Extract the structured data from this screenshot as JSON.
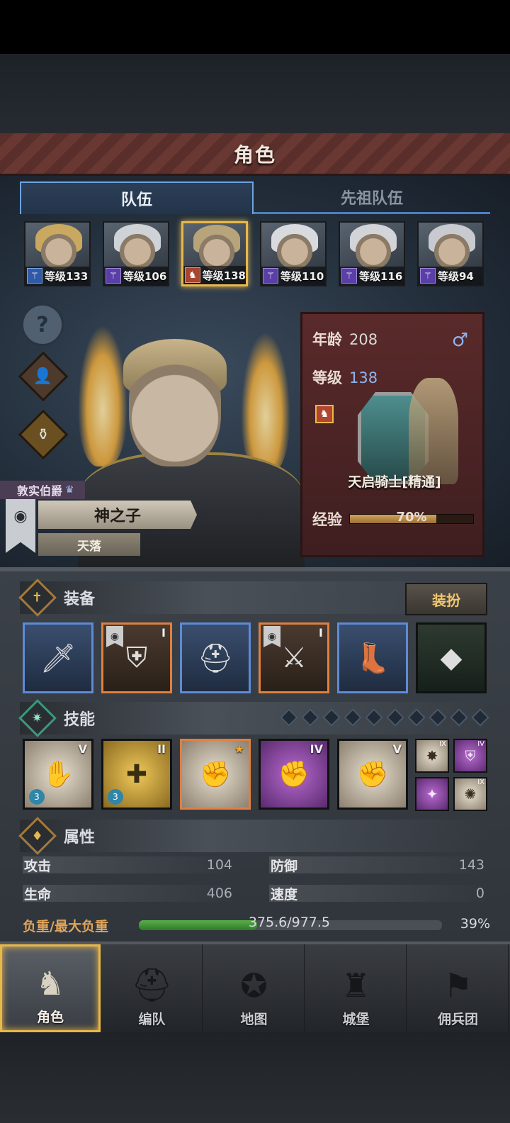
{
  "header": {
    "title": "角色"
  },
  "tabs": [
    {
      "label": "队伍",
      "active": true
    },
    {
      "label": "先祖队伍",
      "active": false
    }
  ],
  "portraits": [
    {
      "level": "等级133",
      "class_color": "blue",
      "hair": "#c9a860",
      "selected": false
    },
    {
      "level": "等级106",
      "class_color": "purple",
      "hair": "#cfd2d6",
      "selected": false
    },
    {
      "level": "等级138",
      "class_color": "red",
      "hair": "#b8a47a",
      "selected": true
    },
    {
      "level": "等级110",
      "class_color": "purple",
      "hair": "#d8dadd",
      "selected": false
    },
    {
      "level": "等级116",
      "class_color": "purple",
      "hair": "#d2d4d8",
      "selected": false
    },
    {
      "level": "等级94",
      "class_color": "purple",
      "hair": "#c8cacf",
      "selected": false
    }
  ],
  "side_buttons": {
    "help_icon": "?",
    "armor_icon": "armor-icon",
    "potion_icon": "potion-icon"
  },
  "hero": {
    "noble_title": "敦实伯爵",
    "name": "神之子",
    "subtitle": "天落"
  },
  "info": {
    "age_label": "年龄",
    "age_value": "208",
    "level_label": "等级",
    "level_value": "138",
    "gender_icon": "♂",
    "class_name": "天启骑士[精通]",
    "exp_label": "经验",
    "exp_percent": "70%",
    "exp_fraction": 0.7
  },
  "equipment": {
    "title": "装备",
    "dress_button": "装扮",
    "slots": [
      {
        "name": "mace",
        "glyph": "🗡",
        "style": "blue",
        "rank": ""
      },
      {
        "name": "shield",
        "glyph": "⛨",
        "style": "orange",
        "rank": "I"
      },
      {
        "name": "helmet",
        "glyph": "⛑",
        "style": "blue",
        "rank": ""
      },
      {
        "name": "armor",
        "glyph": "⚔",
        "style": "orange",
        "rank": "I"
      },
      {
        "name": "boots",
        "glyph": "👢",
        "style": "blue",
        "rank": ""
      },
      {
        "name": "crystal",
        "glyph": "◆",
        "style": "dark",
        "rank": ""
      }
    ]
  },
  "skills": {
    "title": "技能",
    "diamond_count": 10,
    "list": [
      {
        "glyph": "✋",
        "rank": "V",
        "count": "3",
        "style": "sk-white"
      },
      {
        "glyph": "✚",
        "rank": "II",
        "count": "3",
        "style": "sk-gold"
      },
      {
        "glyph": "✊",
        "rank": "★",
        "count": "",
        "style": "sk-white"
      },
      {
        "glyph": "✊",
        "rank": "IV",
        "count": "",
        "style": "sk-purple"
      },
      {
        "glyph": "✊",
        "rank": "V",
        "count": "",
        "style": "sk-white"
      }
    ],
    "mini": [
      {
        "glyph": "✸",
        "rank": "IX",
        "style": "sk-white"
      },
      {
        "glyph": "⛨",
        "rank": "IV",
        "style": "sk-purple"
      },
      {
        "glyph": "✦",
        "rank": "",
        "style": "sk-purple"
      },
      {
        "glyph": "✺",
        "rank": "IX",
        "style": "sk-white"
      }
    ]
  },
  "attributes": {
    "title": "属性",
    "attack_label": "攻击",
    "attack_value": "104",
    "defense_label": "防御",
    "defense_value": "143",
    "hp_label": "生命",
    "hp_value": "406",
    "speed_label": "速度",
    "speed_value": "0",
    "load_label": "负重/最大负重",
    "load_value": "375.6/977.5",
    "load_percent": "39%",
    "load_fraction": 0.39
  },
  "nav": [
    {
      "label": "角色",
      "icon": "knight-icon",
      "glyph": "♞",
      "active": true
    },
    {
      "label": "编队",
      "icon": "helmet-icon",
      "glyph": "⛑",
      "active": false
    },
    {
      "label": "地图",
      "icon": "compass-icon",
      "glyph": "✪",
      "active": false
    },
    {
      "label": "城堡",
      "icon": "castle-icon",
      "glyph": "♜",
      "active": false
    },
    {
      "label": "佣兵团",
      "icon": "banner-icon",
      "glyph": "⚑",
      "active": false
    }
  ]
}
